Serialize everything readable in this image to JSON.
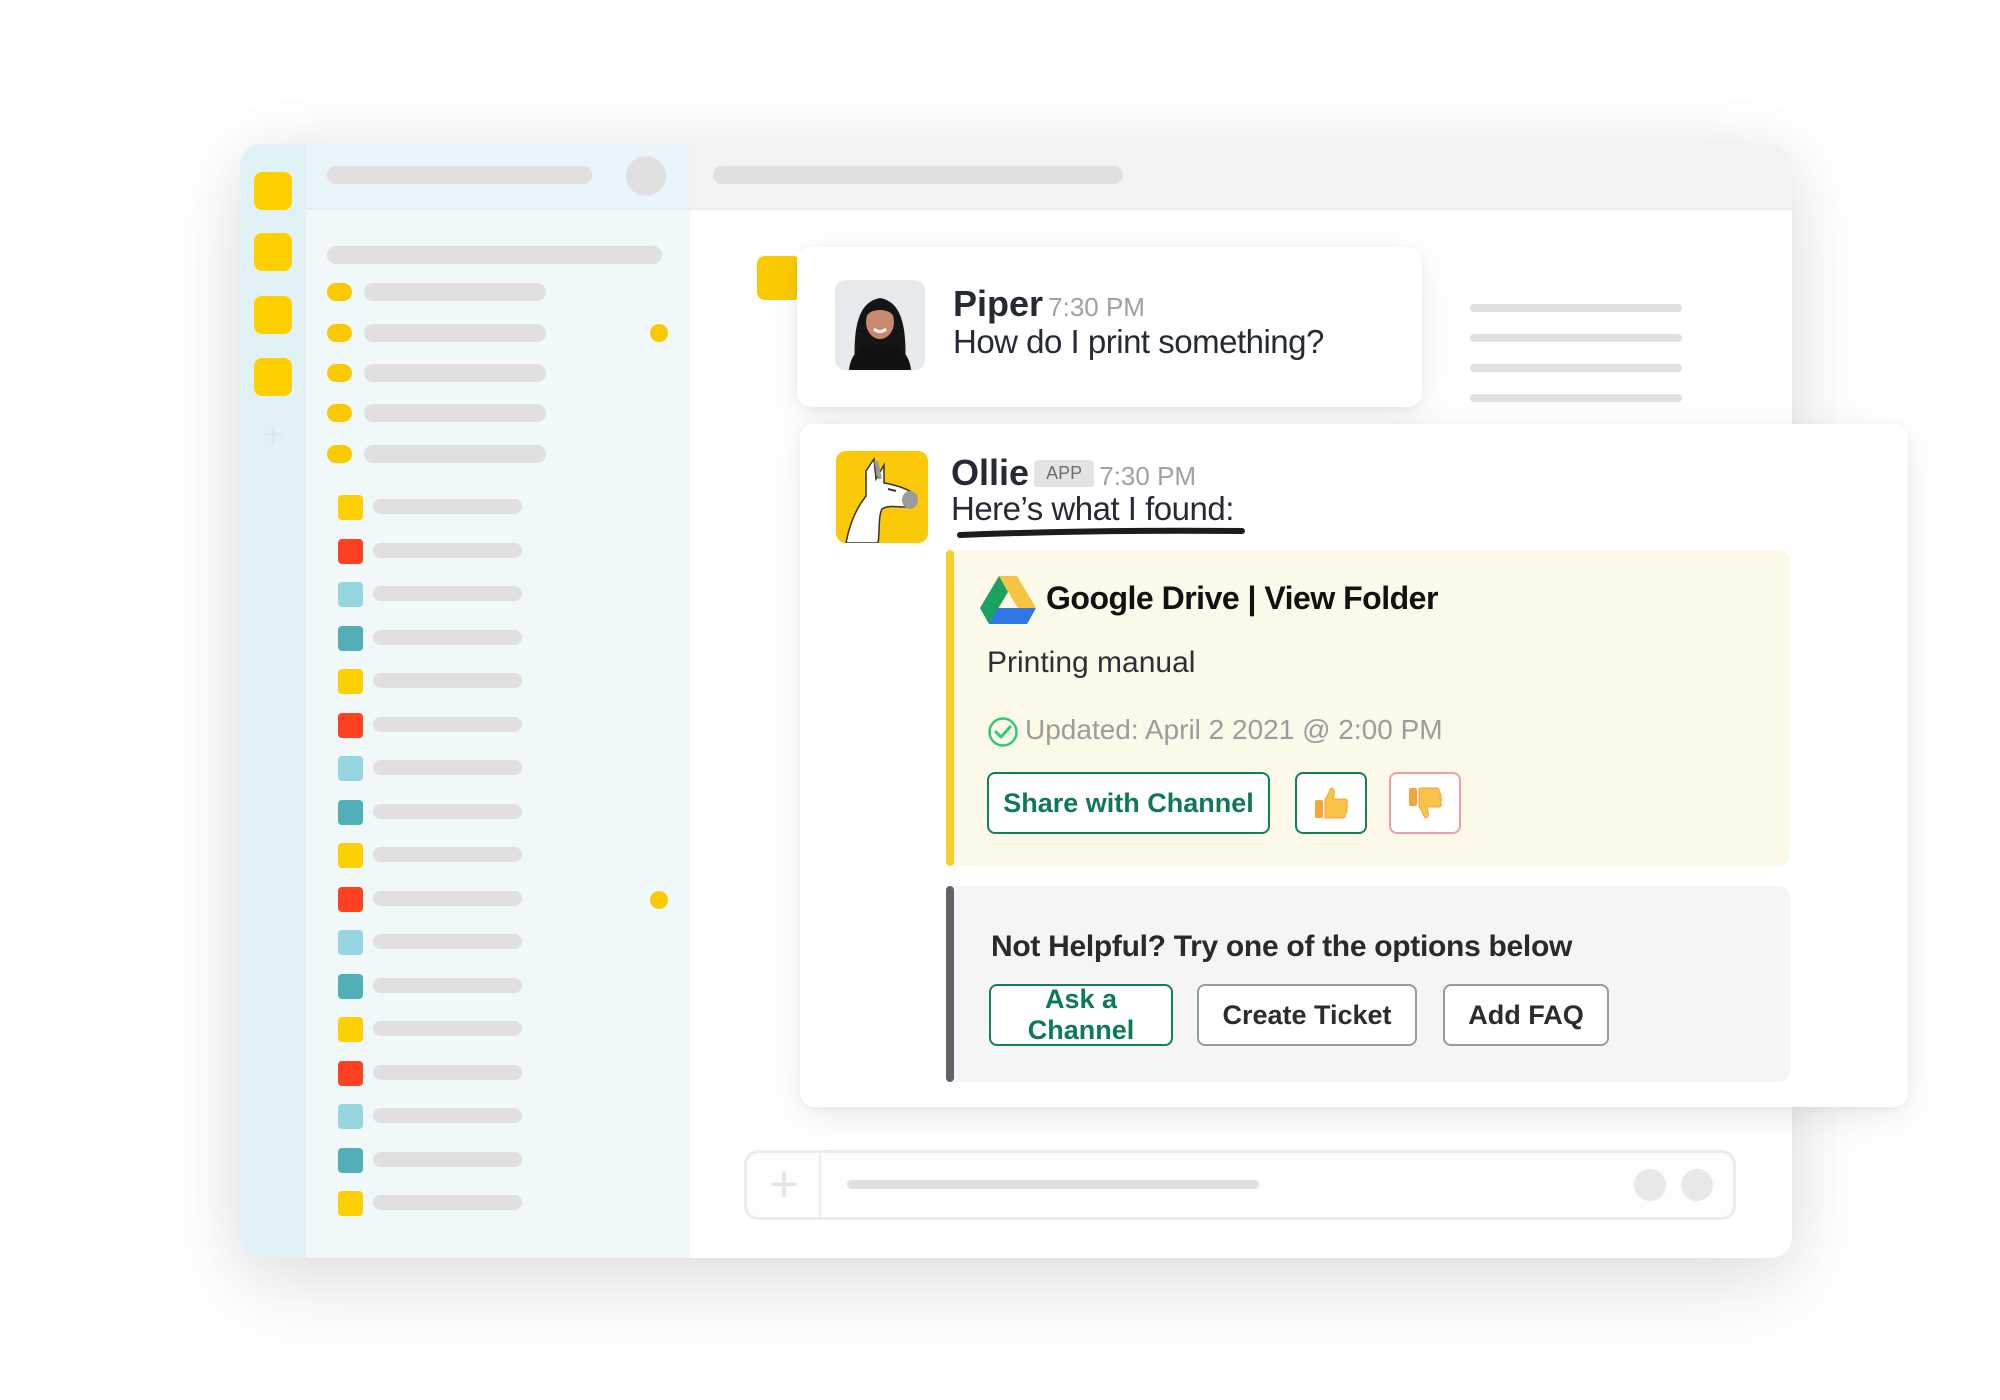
{
  "piper_message": {
    "sender": "Piper",
    "time": "7:30 PM",
    "text": "How do I print something?",
    "avatar": "user-photo"
  },
  "ollie_message": {
    "sender": "Ollie",
    "badge": "APP",
    "time": "7:30 PM",
    "text": "Here’s what I found:",
    "avatar": "llama-icon"
  },
  "result_card": {
    "source_icon": "google-drive-icon",
    "title": "Google Drive | View Folder",
    "document": "Printing manual",
    "status_icon": "check-circle-icon",
    "updated": "Updated: April 2 2021 @ 2:00 PM",
    "share_label": "Share with Channel",
    "thumbs_up_icon": "thumbs-up-icon",
    "thumbs_down_icon": "thumbs-down-icon",
    "accent_color": "#f9cf2b"
  },
  "fallback": {
    "prompt": "Not Helpful? Try one of the options below",
    "buttons": [
      {
        "label": "Ask a Channel"
      },
      {
        "label": "Create Ticket"
      },
      {
        "label": "Add FAQ"
      }
    ]
  },
  "composer": {
    "add_icon": "plus-icon"
  },
  "colors": {
    "brand_yellow": "#ffd000",
    "green": "#0e7a55",
    "channel_red": "#ff4122",
    "channel_light_teal": "#96d6e0",
    "channel_teal": "#50afb7"
  }
}
